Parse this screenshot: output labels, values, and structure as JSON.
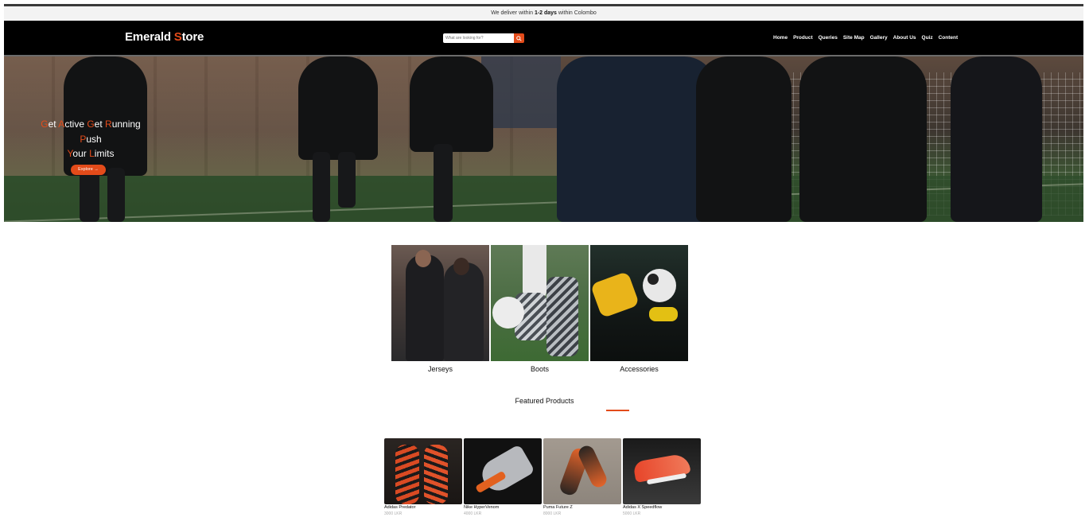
{
  "announcement": {
    "prefix": "We deliver within ",
    "highlight": "1-2 days",
    "suffix": " within Colombo"
  },
  "header": {
    "logo_part1": "Emerald ",
    "logo_accent": "S",
    "logo_part2": "tore",
    "search_placeholder": "What are looking for?",
    "search_icon": "search-icon",
    "nav": [
      "Home",
      "Product",
      "Queries",
      "Site Map",
      "Gallery",
      "About Us",
      "Quiz",
      "Content"
    ]
  },
  "hero": {
    "line1": [
      {
        "a": "G",
        "b": "et "
      },
      {
        "a": "A",
        "b": "ctive "
      },
      {
        "a": "G",
        "b": "et "
      },
      {
        "a": "R",
        "b": "unning"
      }
    ],
    "line2": [
      {
        "a": "P",
        "b": "ush"
      }
    ],
    "line3": [
      {
        "a": "Y",
        "b": "our "
      },
      {
        "a": "L",
        "b": "imits"
      }
    ],
    "button_label": "Explore →"
  },
  "categories": [
    {
      "label": "Jerseys"
    },
    {
      "label": "Boots"
    },
    {
      "label": "Accessories"
    }
  ],
  "featured": {
    "title": "Featured Products",
    "products": [
      {
        "name": "Adidas Predator",
        "price": "3000 LKR"
      },
      {
        "name": "Nike HyperVenom",
        "price": "4000 LKR"
      },
      {
        "name": "Puma Future Z",
        "price": "8000 LKR"
      },
      {
        "name": "Adidas X Speedflow",
        "price": "5000 LKR"
      }
    ]
  },
  "colors": {
    "accent": "#e34b1a",
    "navbar": "#000000"
  }
}
